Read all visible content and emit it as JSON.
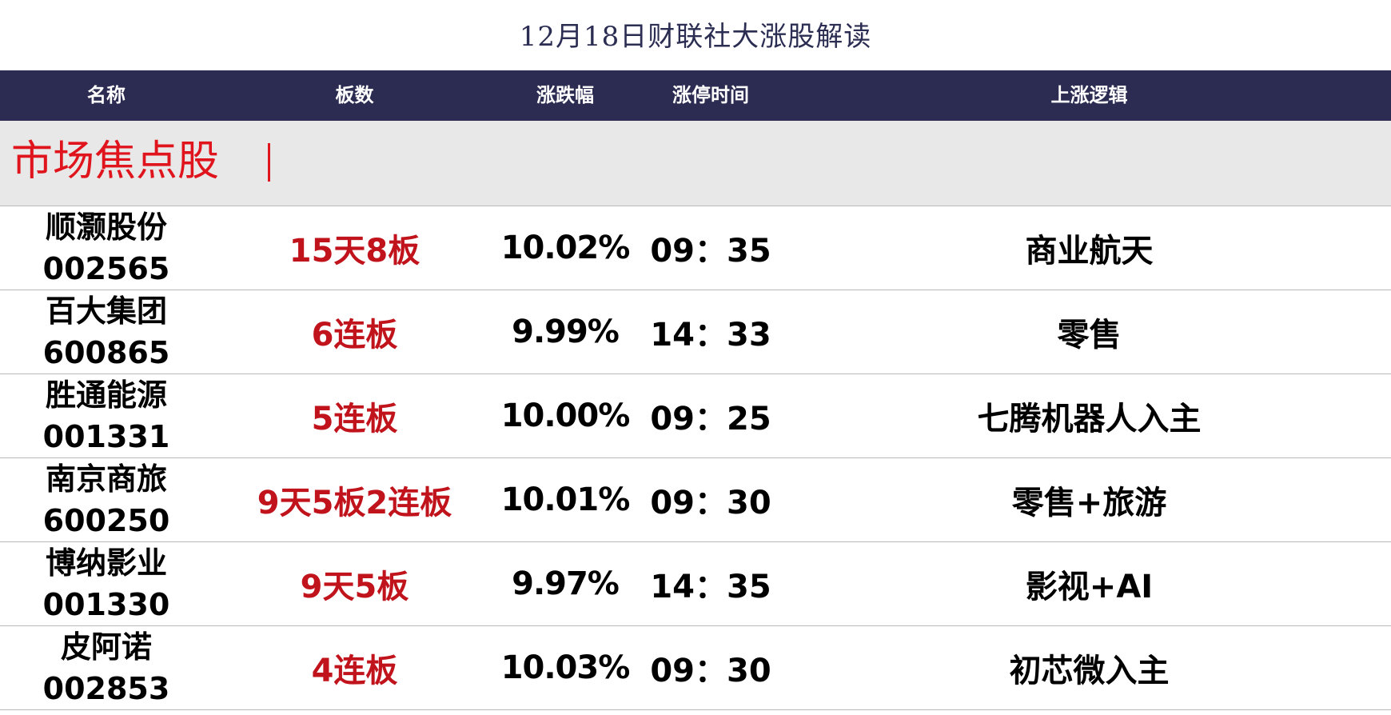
{
  "title": "12月18日财联社大涨股解读",
  "headers": {
    "name": "名称",
    "boards": "板数",
    "change": "涨跌幅",
    "limit_time": "涨停时间",
    "logic": "上涨逻辑"
  },
  "section": {
    "title": "市场焦点股"
  },
  "rows": [
    {
      "name": "顺灏股份",
      "code": "002565",
      "boards": "15天8板",
      "change": "10.02%",
      "time": "09：35",
      "logic": "商业航天"
    },
    {
      "name": "百大集团",
      "code": "600865",
      "boards": "6连板",
      "change": "9.99%",
      "time": "14：33",
      "logic": "零售"
    },
    {
      "name": "胜通能源",
      "code": "001331",
      "boards": "5连板",
      "change": "10.00%",
      "time": "09：25",
      "logic": "七腾机器人入主"
    },
    {
      "name": "南京商旅",
      "code": "600250",
      "boards": "9天5板2连板",
      "change": "10.01%",
      "time": "09：30",
      "logic": "零售+旅游"
    },
    {
      "name": "博纳影业",
      "code": "001330",
      "boards": "9天5板",
      "change": "9.97%",
      "time": "14：35",
      "logic": "影视+AI"
    },
    {
      "name": "皮阿诺",
      "code": "002853",
      "boards": "4连板",
      "change": "10.03%",
      "time": "09：30",
      "logic": "初芯微入主"
    }
  ],
  "colors": {
    "header_bg": "#2c2c52",
    "section_bg": "#e8e8e8",
    "accent_red": "#c0131b",
    "title_color": "#2b2d52"
  }
}
